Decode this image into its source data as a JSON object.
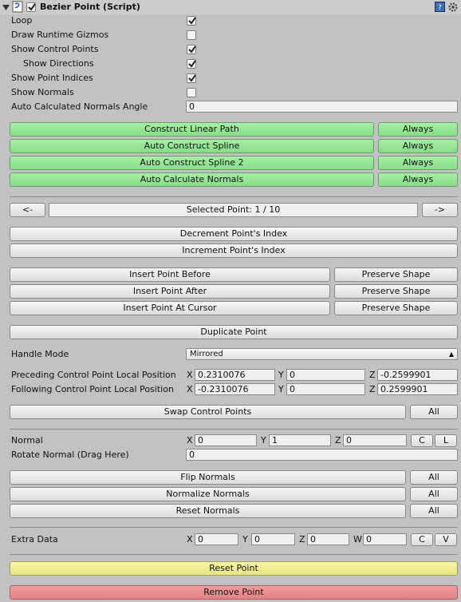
{
  "header": {
    "title": "Bezier Point (Script)",
    "collapse_icon": "triangle-down-icon",
    "script_icon": "script-file-icon",
    "help_icon": "book-help-icon"
  },
  "toggles": [
    {
      "label": "Loop",
      "checked": true
    },
    {
      "label": "Draw Runtime Gizmos",
      "checked": false
    },
    {
      "label": "Show Control Points",
      "checked": true
    },
    {
      "label": "Show Directions",
      "checked": true
    },
    {
      "label": "Show Point Indices",
      "checked": true
    },
    {
      "label": "Show Normals",
      "checked": false
    }
  ],
  "normals_angle": {
    "label": "Auto Calculated Normals Angle",
    "value": "0"
  },
  "construct": [
    {
      "label": "Construct Linear Path",
      "mode": "Always"
    },
    {
      "label": "Auto Construct Spline",
      "mode": "Always"
    },
    {
      "label": "Auto Construct Spline 2",
      "mode": "Always"
    },
    {
      "label": "Auto Calculate Normals",
      "mode": "Always"
    }
  ],
  "nav": {
    "prev": "<-",
    "next": "->",
    "selected": "Selected Point: 1 / 10"
  },
  "index_buttons": {
    "decrement": "Decrement Point's Index",
    "increment": "Increment Point's Index"
  },
  "insert": [
    {
      "label": "Insert Point Before",
      "option": "Preserve Shape"
    },
    {
      "label": "Insert Point After",
      "option": "Preserve Shape"
    },
    {
      "label": "Insert Point At Cursor",
      "option": "Preserve Shape"
    }
  ],
  "duplicate": "Duplicate Point",
  "handle_mode": {
    "label": "Handle Mode",
    "value": "Mirrored"
  },
  "control_points": {
    "preceding": {
      "label": "Preceding Control Point Local Position",
      "x": "0.2310076",
      "y": "0",
      "z": "-0.2599901"
    },
    "following": {
      "label": "Following Control Point Local Position",
      "x": "-0.2310076",
      "y": "0",
      "z": "0.2599901"
    },
    "swap": "Swap Control Points",
    "all": "All"
  },
  "normal": {
    "label": "Normal",
    "x": "0",
    "y": "1",
    "z": "0",
    "copy": "C",
    "local": "L"
  },
  "rotate_normal": {
    "label": "Rotate Normal (Drag Here)",
    "value": "0"
  },
  "normal_buttons": [
    {
      "label": "Flip Normals",
      "all": "All"
    },
    {
      "label": "Normalize Normals",
      "all": "All"
    },
    {
      "label": "Reset Normals",
      "all": "All"
    }
  ],
  "extra_data": {
    "label": "Extra Data",
    "x": "0",
    "y": "0",
    "z": "0",
    "w": "0",
    "copy": "C",
    "visualize": "V"
  },
  "axes": {
    "x": "X",
    "y": "Y",
    "z": "Z",
    "w": "W"
  },
  "reset_point": "Reset Point",
  "remove_point": "Remove Point",
  "colors": {
    "green": "#8fe38f",
    "yellow": "#ecec8c",
    "red": "#e88a8a",
    "background": "#c2c2c2"
  }
}
